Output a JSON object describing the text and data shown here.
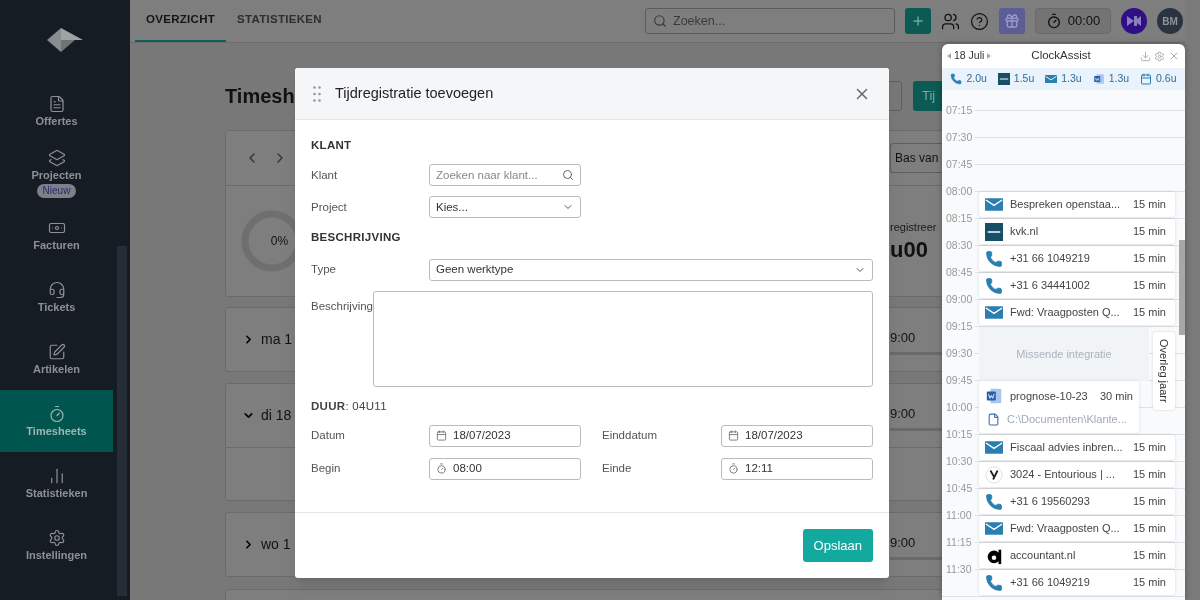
{
  "sidebar": {
    "items": [
      {
        "label": "Offertes",
        "selected": false
      },
      {
        "label": "Projecten",
        "badge": "Nieuw",
        "selected": false
      },
      {
        "label": "Facturen",
        "selected": false
      },
      {
        "label": "Tickets",
        "selected": false
      },
      {
        "label": "Artikelen",
        "selected": false
      },
      {
        "label": "Timesheets",
        "selected": true
      },
      {
        "label": "Statistieken",
        "selected": false
      },
      {
        "label": "Instellingen",
        "selected": false
      }
    ]
  },
  "top_bar": {
    "tabs": [
      {
        "label": "OVERZICHT",
        "selected": true
      },
      {
        "label": "STATISTIEKEN",
        "selected": false
      }
    ],
    "search": {
      "placeholder": "Zoeken..."
    },
    "timer": "00:00",
    "avatar": "BM"
  },
  "background": {
    "title": "Timesh",
    "button": "Tij",
    "select": "Bas van",
    "progress": "0%",
    "stat_label": "registreer",
    "stat_value": "u00",
    "days": [
      {
        "label": "ma 1",
        "time": "9:00",
        "expanded": false
      },
      {
        "label": "di 18",
        "time": "9:00",
        "expanded": true
      },
      {
        "label": "wo 1",
        "time": "9:00",
        "expanded": false
      }
    ]
  },
  "dialog": {
    "title": "Tijdregistratie toevoegen",
    "klant_heading": "KLANT",
    "klant": {
      "label": "Klant",
      "placeholder": "Zoeken naar klant..."
    },
    "project": {
      "label": "Project",
      "value": "Kies..."
    },
    "beschrijving_heading": "BESCHRIJVING",
    "type": {
      "label": "Type",
      "value": "Geen werktype"
    },
    "description": {
      "label": "Beschrijving"
    },
    "duration": "**DUUR**: 04U11",
    "datum": {
      "label": "Datum",
      "value": "18/07/2023"
    },
    "einddatum": {
      "label": "Einddatum",
      "value": "18/07/2023"
    },
    "begin": {
      "label": "Begin",
      "value": "08:00"
    },
    "einde": {
      "label": "Einde",
      "value": "12:11"
    },
    "save_button": "Opslaan"
  },
  "clockassist": {
    "date": "18 Juli",
    "title": "ClockAssist",
    "totals": [
      {
        "kind": "phone",
        "value": "2.0u"
      },
      {
        "kind": "kvk",
        "value": "1.5u"
      },
      {
        "kind": "mail",
        "value": "1.3u"
      },
      {
        "kind": "word",
        "value": "1.3u"
      },
      {
        "kind": "calendar",
        "value": "0.6u"
      }
    ],
    "times": [
      "07:15",
      "07:30",
      "07:45",
      "08:00",
      "08:15",
      "08:30",
      "08:45",
      "09:00",
      "09:15",
      "09:30",
      "09:45",
      "10:00",
      "10:15",
      "10:30",
      "10:45",
      "11:00",
      "11:15",
      "11:30"
    ],
    "entries": [
      {
        "kind": "mail",
        "title": "Bespreken openstaa...",
        "duration": "15 min"
      },
      {
        "kind": "kvk",
        "title": "kvk.nl",
        "duration": "15 min"
      },
      {
        "kind": "phone",
        "title": "+31 66 1049219",
        "duration": "15 min"
      },
      {
        "kind": "phone",
        "title": "+31 6 34441002",
        "duration": "15 min"
      },
      {
        "kind": "mail",
        "title": "Fwd: Vraagposten Q...",
        "duration": "15 min"
      },
      {
        "kind": "gap",
        "title": "Missende integratie"
      },
      {
        "kind": "word",
        "title": "prognose-10-23",
        "duration": "30 min",
        "path": "C:\\Documenten\\Klante..."
      },
      {
        "kind": "mail",
        "title": "Fiscaal advies inbren...",
        "duration": "15 min"
      },
      {
        "kind": "round-logo",
        "title": "3024 - Entourious | ...",
        "duration": "15 min"
      },
      {
        "kind": "phone",
        "title": "+31 6 19560293",
        "duration": "15 min"
      },
      {
        "kind": "mail",
        "title": "Fwd: Vraagposten Q...",
        "duration": "15 min"
      },
      {
        "kind": "black-logo",
        "title": "accountant.nl",
        "duration": "15 min"
      },
      {
        "kind": "phone",
        "title": "+31 66 1049219",
        "duration": "15 min"
      }
    ],
    "side_tab": "Overleg jaarr"
  }
}
